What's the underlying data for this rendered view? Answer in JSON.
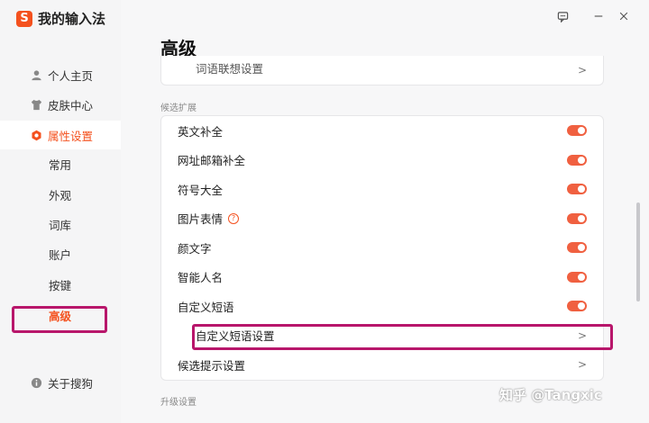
{
  "app": {
    "title": "我的输入法",
    "logo_char": "S"
  },
  "sidebar": {
    "items": [
      {
        "label": "个人主页"
      },
      {
        "label": "皮肤中心"
      },
      {
        "label": "属性设置"
      }
    ],
    "subitems": [
      {
        "label": "常用"
      },
      {
        "label": "外观"
      },
      {
        "label": "词库"
      },
      {
        "label": "账户"
      },
      {
        "label": "按键"
      },
      {
        "label": "高级"
      }
    ],
    "about": "关于搜狗"
  },
  "main": {
    "title": "高级",
    "partial_row": "词语联想设置",
    "section1": "候选扩展",
    "rows": [
      {
        "label": "英文补全",
        "on": true
      },
      {
        "label": "网址邮箱补全",
        "on": true
      },
      {
        "label": "符号大全",
        "on": true
      },
      {
        "label": "图片表情",
        "on": true,
        "help": "?"
      },
      {
        "label": "颜文字",
        "on": true
      },
      {
        "label": "智能人名",
        "on": true
      },
      {
        "label": "自定义短语",
        "on": true
      }
    ],
    "custom_phrase_settings": "自定义短语设置",
    "candidate_hint_settings": "候选提示设置",
    "section2": "升级设置"
  },
  "watermark": "知乎 @Tangxic",
  "colors": {
    "accent": "#f4511e",
    "toggle_on": "#f06040",
    "highlight": "#b8166b"
  }
}
